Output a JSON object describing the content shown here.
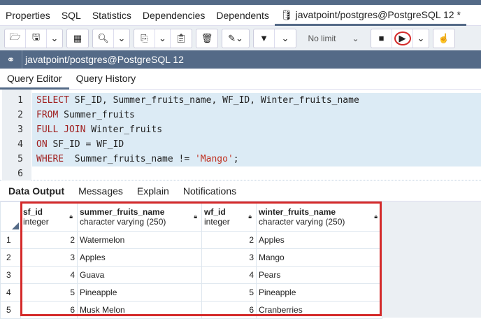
{
  "tabs": [
    "Properties",
    "SQL",
    "Statistics",
    "Dependencies",
    "Dependents",
    "javatpoint/postgres@PostgreSQL 12 *"
  ],
  "toolbar": {
    "limit": "No limit"
  },
  "connection": {
    "title": "javatpoint/postgres@PostgreSQL 12"
  },
  "query_tabs": [
    "Query Editor",
    "Query History"
  ],
  "editor": {
    "lines": [
      {
        "n": "1",
        "kw": "SELECT",
        "rest": " SF_ID, Summer_fruits_name, WF_ID, Winter_fruits_name"
      },
      {
        "n": "2",
        "kw": "FROM",
        "rest": " Summer_fruits"
      },
      {
        "n": "3",
        "kw": "FULL JOIN",
        "rest": " Winter_fruits"
      },
      {
        "n": "4",
        "kw": "ON",
        "rest": " SF_ID = WF_ID"
      },
      {
        "n": "5",
        "kw": "WHERE",
        "rest": "  Summer_fruits_name != ",
        "str": "'Mango'",
        "end": ";"
      },
      {
        "n": "6",
        "kw": "",
        "rest": ""
      }
    ]
  },
  "output_tabs": [
    "Data Output",
    "Messages",
    "Explain",
    "Notifications"
  ],
  "columns": [
    {
      "name": "sf_id",
      "type": "integer"
    },
    {
      "name": "summer_fruits_name",
      "type": "character varying (250)"
    },
    {
      "name": "wf_id",
      "type": "integer"
    },
    {
      "name": "winter_fruits_name",
      "type": "character varying (250)"
    }
  ],
  "rows": [
    [
      "1",
      "2",
      "Watermelon",
      "2",
      "Apples"
    ],
    [
      "2",
      "3",
      "Apples",
      "3",
      "Mango"
    ],
    [
      "3",
      "4",
      "Guava",
      "4",
      "Pears"
    ],
    [
      "4",
      "5",
      "Pineapple",
      "5",
      "Pineapple"
    ],
    [
      "5",
      "6",
      "Musk Melon",
      "6",
      "Cranberries"
    ]
  ],
  "colors": {
    "header": "#546a87",
    "highlight": "#d42a2a",
    "keyword": "#a02020"
  }
}
